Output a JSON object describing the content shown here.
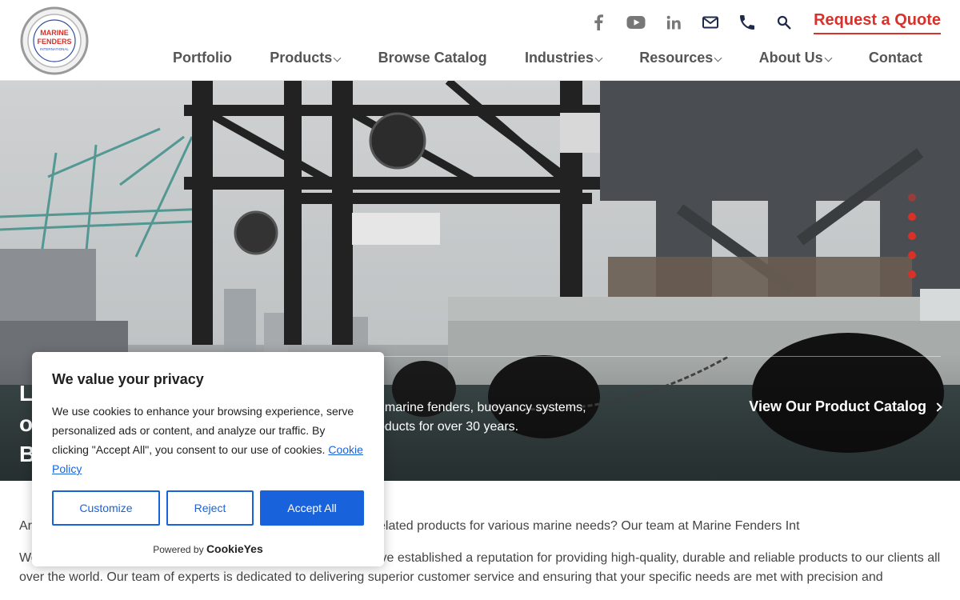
{
  "header": {
    "logo": {
      "alt": "Marine Fenders International",
      "text_lines": [
        "MARINE",
        "FENDERS"
      ],
      "sub_text": "INTERNATIONAL",
      "ring_text": "DESIGN OCEANS · FOAM FILLED FENDERS"
    },
    "utility_icons": [
      "facebook-icon",
      "youtube-icon",
      "linkedin-icon",
      "email-icon",
      "phone-icon",
      "search-icon"
    ],
    "quote_label": "Request a Quote",
    "nav": [
      {
        "label": "Portfolio",
        "has_dropdown": false
      },
      {
        "label": "Products",
        "has_dropdown": true
      },
      {
        "label": "Browse Catalog",
        "has_dropdown": false
      },
      {
        "label": "Industries",
        "has_dropdown": true
      },
      {
        "label": "Resources",
        "has_dropdown": true
      },
      {
        "label": "About Us",
        "has_dropdown": true
      },
      {
        "label": "Contact",
        "has_dropdown": false
      }
    ]
  },
  "hero": {
    "heading_lines": [
      "L",
      "o",
      "B"
    ],
    "text": "f marine fenders, buoyancy systems, oducts for over 30 years.",
    "cta_label": "View Our Product Catalog",
    "slides": 5,
    "active_slide": 1
  },
  "content": {
    "para1": "Ar                                                          els, mooring buoys and related products for various marine needs? Our team at Marine Fenders Int",
    "para2": "We have decades of experience in the maritime industry and have established a reputation for providing high-quality, durable and reliable products to our clients all over the world. Our team of experts is dedicated to delivering superior customer service and ensuring that your specific needs are met with precision and"
  },
  "cookie": {
    "title": "We value your privacy",
    "text": "We use cookies to enhance your browsing experience, serve personalized ads or content, and analyze our traffic. By clicking \"Accept All\", you consent to our use of cookies.",
    "link": "Cookie Policy",
    "customize": "Customize",
    "reject": "Reject",
    "accept": "Accept All",
    "powered_by": "Powered by",
    "brand": "CookieYes"
  },
  "colors": {
    "accent_red": "#d9302a",
    "cookie_blue": "#1863dc",
    "nav_text": "#555555"
  }
}
